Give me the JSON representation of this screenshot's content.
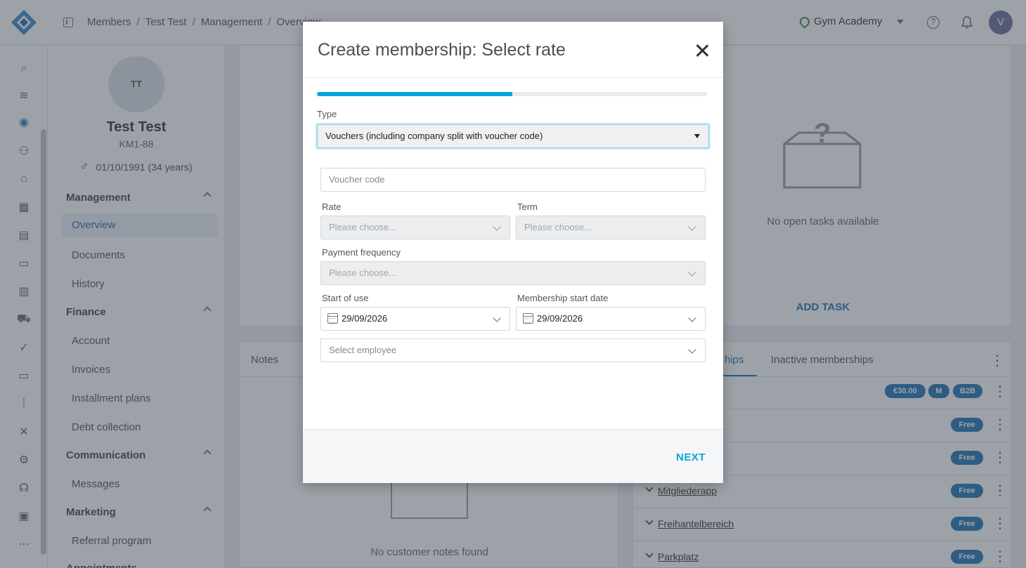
{
  "topbar": {
    "breadcrumb": [
      "Members",
      "Test Test",
      "Management",
      "Overview"
    ],
    "studio": "Gym Academy",
    "help_glyph": "?",
    "user_initial": "V"
  },
  "profile": {
    "initials": "TT",
    "name": "Test Test",
    "member_id": "KM1-88",
    "dob": "01/10/1991 (34 years)"
  },
  "sidebar": {
    "sections": [
      {
        "title": "Management",
        "items": [
          "Overview",
          "Documents",
          "History"
        ]
      },
      {
        "title": "Finance",
        "items": [
          "Account",
          "Invoices",
          "Installment plans",
          "Debt collection"
        ]
      },
      {
        "title": "Communication",
        "items": [
          "Messages"
        ]
      },
      {
        "title": "Marketing",
        "items": [
          "Referral program"
        ]
      },
      {
        "title": "Appointments",
        "items": []
      }
    ],
    "active_item": "Overview"
  },
  "tasks": {
    "empty_text": "No open tasks available",
    "add_label": "ADD TASK"
  },
  "notes": {
    "tab_label": "Notes",
    "empty_text": "No customer notes found"
  },
  "memberships": {
    "tabs": [
      "Active memberships",
      "Inactive memberships"
    ],
    "visible_tab_fragment": "hips",
    "top_badges": [
      "€30.00",
      "M",
      "B2B"
    ],
    "rows": [
      {
        "name": "",
        "badge": "Free"
      },
      {
        "name": "",
        "badge": "Free"
      },
      {
        "name": "Mitgliederapp",
        "badge": "Free"
      },
      {
        "name": "Freihantelbereich",
        "badge": "Free"
      },
      {
        "name": "Parkplatz",
        "badge": "Free"
      }
    ]
  },
  "modal": {
    "title": "Create membership: Select rate",
    "progress": 0.5,
    "type_label": "Type",
    "type_value": "Vouchers (including company split with voucher code)",
    "voucher_placeholder": "Voucher code",
    "rate_label": "Rate",
    "rate_placeholder": "Please choose...",
    "term_label": "Term",
    "term_placeholder": "Please choose...",
    "payment_label": "Payment frequency",
    "payment_placeholder": "Please choose...",
    "start_use_label": "Start of use",
    "start_use_value": "29/09/2026",
    "membership_start_label": "Membership start date",
    "membership_start_value": "29/09/2026",
    "employee_placeholder": "Select employee",
    "next_label": "NEXT"
  },
  "colors": {
    "accent": "#0aa5de",
    "brand": "#1e76b3",
    "progress_track": "#e9ebee"
  }
}
